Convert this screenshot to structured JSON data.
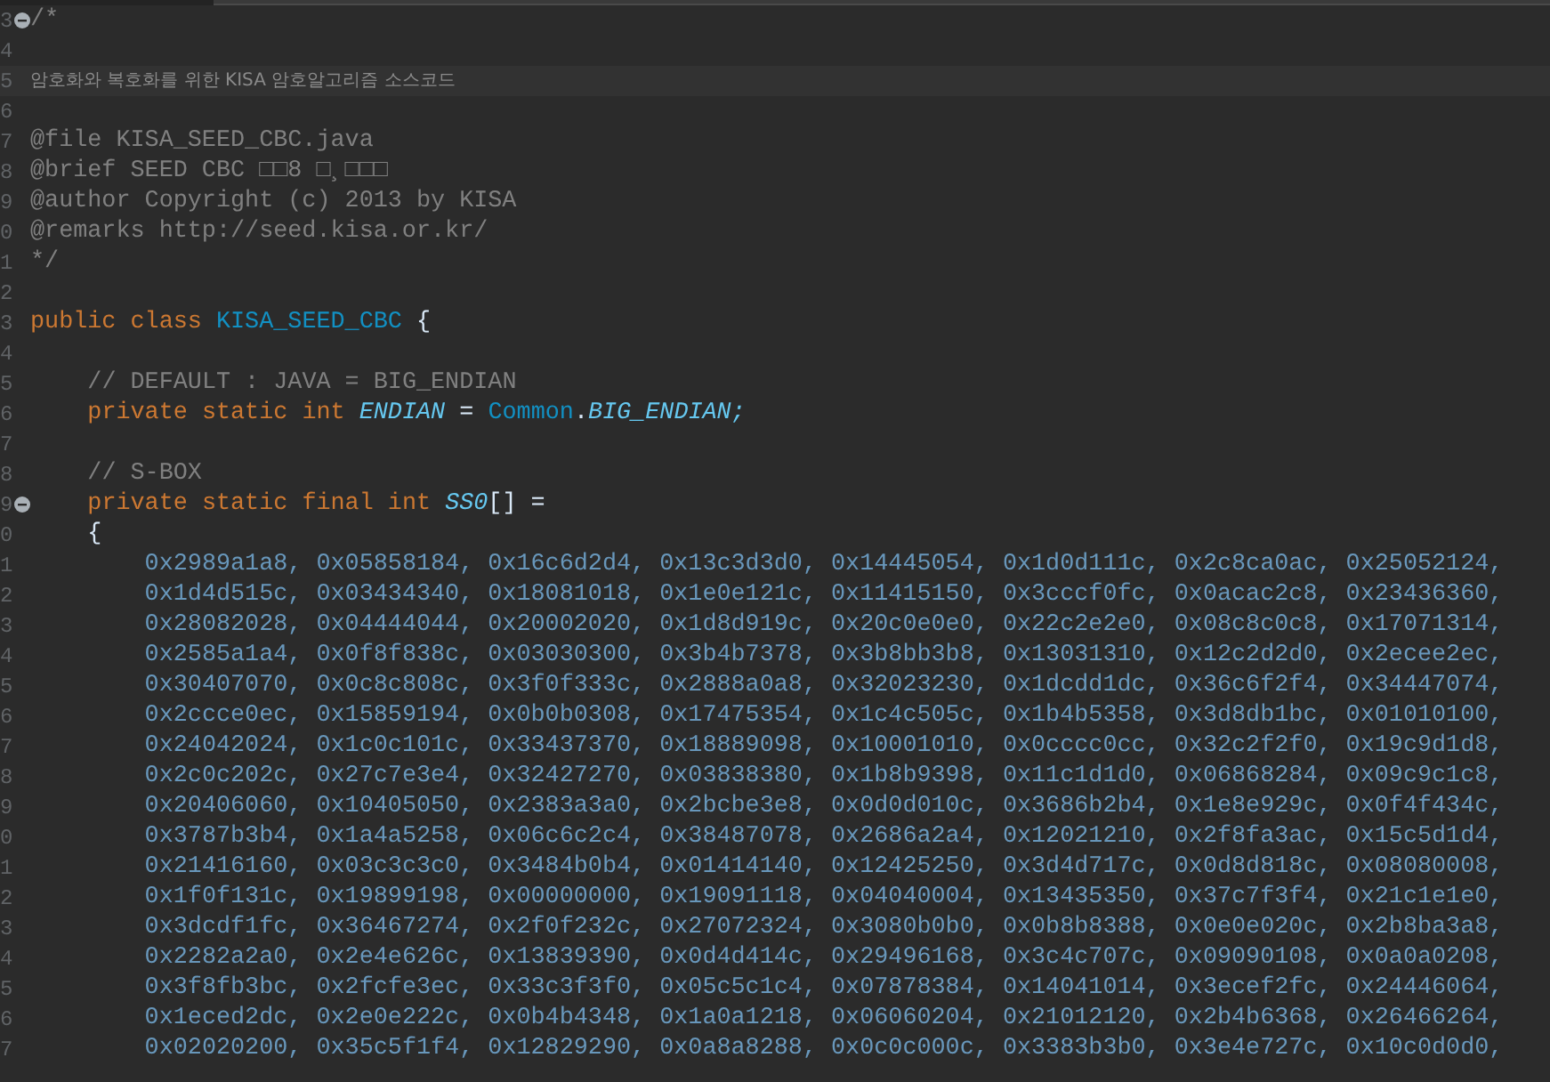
{
  "editor": {
    "lines": [
      {
        "number": "3",
        "fold": true,
        "current": false,
        "tokens": [
          {
            "text": "/*",
            "kind": "comment"
          }
        ]
      },
      {
        "number": "4",
        "fold": false,
        "current": false
      },
      {
        "number": "5",
        "fold": false,
        "current": true,
        "tokens": [
          {
            "text": "암호화와 복호화를 위한 KISA 암호알고리즘 소스코드",
            "kind": "comment-cjk"
          }
        ]
      },
      {
        "number": "6",
        "fold": false,
        "current": false
      },
      {
        "number": "7",
        "fold": false,
        "current": false,
        "tokens": [
          {
            "text": "@file KISA_SEED_CBC.java",
            "kind": "comment"
          }
        ]
      },
      {
        "number": "8",
        "fold": false,
        "current": false,
        "tokens": [
          {
            "text": "@brief SEED CBC □□8 □¸□□□",
            "kind": "comment"
          }
        ]
      },
      {
        "number": "9",
        "fold": false,
        "current": false,
        "tokens": [
          {
            "text": "@author Copyright (c) 2013 by KISA",
            "kind": "comment"
          }
        ]
      },
      {
        "number": "0",
        "fold": false,
        "current": false,
        "tokens": [
          {
            "text": "@remarks http://seed.kisa.or.kr/",
            "kind": "comment"
          }
        ]
      },
      {
        "number": "1",
        "fold": false,
        "current": false,
        "tokens": [
          {
            "text": "*/",
            "kind": "comment"
          }
        ]
      },
      {
        "number": "2",
        "fold": false,
        "current": false
      },
      {
        "number": "3",
        "fold": false,
        "current": false,
        "tokens": [
          {
            "text": "public class ",
            "kind": "keyword"
          },
          {
            "text": "KISA_SEED_CBC",
            "kind": "type"
          },
          {
            "text": " {",
            "kind": "plain"
          }
        ]
      },
      {
        "number": "4",
        "fold": false,
        "current": false
      },
      {
        "number": "5",
        "fold": false,
        "current": false,
        "tokens": [
          {
            "text": "    // DEFAULT : JAVA = BIG_ENDIAN",
            "kind": "comment"
          }
        ]
      },
      {
        "number": "6",
        "fold": false,
        "current": false,
        "tokens": [
          {
            "text": "    private static int ",
            "kind": "keyword"
          },
          {
            "text": "ENDIAN",
            "kind": "field"
          },
          {
            "text": " = ",
            "kind": "plain"
          },
          {
            "text": "Common",
            "kind": "type"
          },
          {
            "text": ".",
            "kind": "plain"
          },
          {
            "text": "BIG_ENDIAN;",
            "kind": "field"
          }
        ]
      },
      {
        "number": "7",
        "fold": false,
        "current": false
      },
      {
        "number": "8",
        "fold": false,
        "current": false,
        "tokens": [
          {
            "text": "    // S-BOX",
            "kind": "comment"
          }
        ]
      },
      {
        "number": "9",
        "fold": true,
        "current": false,
        "tokens": [
          {
            "text": "    private static final int ",
            "kind": "keyword"
          },
          {
            "text": "SS0",
            "kind": "field"
          },
          {
            "text": "[] =",
            "kind": "plain"
          }
        ]
      },
      {
        "number": "0",
        "fold": false,
        "current": false,
        "tokens": [
          {
            "text": "    {",
            "kind": "plain"
          }
        ]
      },
      {
        "number": "1",
        "fold": false,
        "current": false,
        "tokens": [
          {
            "text": "        0x2989a1a8, 0x05858184, 0x16c6d2d4, 0x13c3d3d0, 0x14445054, 0x1d0d111c, 0x2c8ca0ac, 0x25052124,",
            "kind": "number"
          }
        ]
      },
      {
        "number": "2",
        "fold": false,
        "current": false,
        "tokens": [
          {
            "text": "        0x1d4d515c, 0x03434340, 0x18081018, 0x1e0e121c, 0x11415150, 0x3cccf0fc, 0x0acac2c8, 0x23436360,",
            "kind": "number"
          }
        ]
      },
      {
        "number": "3",
        "fold": false,
        "current": false,
        "tokens": [
          {
            "text": "        0x28082028, 0x04444044, 0x20002020, 0x1d8d919c, 0x20c0e0e0, 0x22c2e2e0, 0x08c8c0c8, 0x17071314,",
            "kind": "number"
          }
        ]
      },
      {
        "number": "4",
        "fold": false,
        "current": false,
        "tokens": [
          {
            "text": "        0x2585a1a4, 0x0f8f838c, 0x03030300, 0x3b4b7378, 0x3b8bb3b8, 0x13031310, 0x12c2d2d0, 0x2ecee2ec,",
            "kind": "number"
          }
        ]
      },
      {
        "number": "5",
        "fold": false,
        "current": false,
        "tokens": [
          {
            "text": "        0x30407070, 0x0c8c808c, 0x3f0f333c, 0x2888a0a8, 0x32023230, 0x1dcdd1dc, 0x36c6f2f4, 0x34447074,",
            "kind": "number"
          }
        ]
      },
      {
        "number": "6",
        "fold": false,
        "current": false,
        "tokens": [
          {
            "text": "        0x2ccce0ec, 0x15859194, 0x0b0b0308, 0x17475354, 0x1c4c505c, 0x1b4b5358, 0x3d8db1bc, 0x01010100,",
            "kind": "number"
          }
        ]
      },
      {
        "number": "7",
        "fold": false,
        "current": false,
        "tokens": [
          {
            "text": "        0x24042024, 0x1c0c101c, 0x33437370, 0x18889098, 0x10001010, 0x0cccc0cc, 0x32c2f2f0, 0x19c9d1d8,",
            "kind": "number"
          }
        ]
      },
      {
        "number": "8",
        "fold": false,
        "current": false,
        "tokens": [
          {
            "text": "        0x2c0c202c, 0x27c7e3e4, 0x32427270, 0x03838380, 0x1b8b9398, 0x11c1d1d0, 0x06868284, 0x09c9c1c8,",
            "kind": "number"
          }
        ]
      },
      {
        "number": "9",
        "fold": false,
        "current": false,
        "tokens": [
          {
            "text": "        0x20406060, 0x10405050, 0x2383a3a0, 0x2bcbe3e8, 0x0d0d010c, 0x3686b2b4, 0x1e8e929c, 0x0f4f434c,",
            "kind": "number"
          }
        ]
      },
      {
        "number": "0",
        "fold": false,
        "current": false,
        "tokens": [
          {
            "text": "        0x3787b3b4, 0x1a4a5258, 0x06c6c2c4, 0x38487078, 0x2686a2a4, 0x12021210, 0x2f8fa3ac, 0x15c5d1d4,",
            "kind": "number"
          }
        ]
      },
      {
        "number": "1",
        "fold": false,
        "current": false,
        "tokens": [
          {
            "text": "        0x21416160, 0x03c3c3c0, 0x3484b0b4, 0x01414140, 0x12425250, 0x3d4d717c, 0x0d8d818c, 0x08080008,",
            "kind": "number"
          }
        ]
      },
      {
        "number": "2",
        "fold": false,
        "current": false,
        "tokens": [
          {
            "text": "        0x1f0f131c, 0x19899198, 0x00000000, 0x19091118, 0x04040004, 0x13435350, 0x37c7f3f4, 0x21c1e1e0,",
            "kind": "number"
          }
        ]
      },
      {
        "number": "3",
        "fold": false,
        "current": false,
        "tokens": [
          {
            "text": "        0x3dcdf1fc, 0x36467274, 0x2f0f232c, 0x27072324, 0x3080b0b0, 0x0b8b8388, 0x0e0e020c, 0x2b8ba3a8,",
            "kind": "number"
          }
        ]
      },
      {
        "number": "4",
        "fold": false,
        "current": false,
        "tokens": [
          {
            "text": "        0x2282a2a0, 0x2e4e626c, 0x13839390, 0x0d4d414c, 0x29496168, 0x3c4c707c, 0x09090108, 0x0a0a0208,",
            "kind": "number"
          }
        ]
      },
      {
        "number": "5",
        "fold": false,
        "current": false,
        "tokens": [
          {
            "text": "        0x3f8fb3bc, 0x2fcfe3ec, 0x33c3f3f0, 0x05c5c1c4, 0x07878384, 0x14041014, 0x3ecef2fc, 0x24446064,",
            "kind": "number"
          }
        ]
      },
      {
        "number": "6",
        "fold": false,
        "current": false,
        "tokens": [
          {
            "text": "        0x1eced2dc, 0x2e0e222c, 0x0b4b4348, 0x1a0a1218, 0x06060204, 0x21012120, 0x2b4b6368, 0x26466264,",
            "kind": "number"
          }
        ]
      },
      {
        "number": "7",
        "fold": false,
        "current": false,
        "tokens": [
          {
            "text": "        0x02020200, 0x35c5f1f4, 0x12829290, 0x0a8a8288, 0x0c0c000c, 0x3383b3b0, 0x3e4e727c, 0x10c0d0d0,",
            "kind": "number"
          }
        ]
      }
    ]
  }
}
